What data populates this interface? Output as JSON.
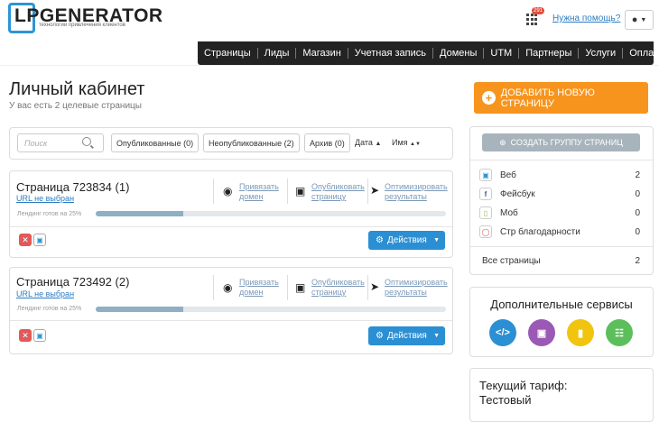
{
  "brand": {
    "name": "LPGENERATOR",
    "tagline": "технологии привлечения клиентов",
    "accent": "#2b95d6"
  },
  "header": {
    "notifications_count": "291",
    "help_link": "Нужна помощь?",
    "user_menu_icon": "user-icon"
  },
  "nav": {
    "items": [
      "Страницы",
      "Лиды",
      "Магазин",
      "Учетная запись",
      "Домены",
      "UTM",
      "Партнеры",
      "Услуги",
      "Оплата"
    ]
  },
  "page": {
    "title": "Личный кабинет",
    "subtitle": "У вас есть 2 целевые страницы",
    "add_button": "ДОБАВИТЬ НОВУЮ СТРАНИЦУ"
  },
  "filter": {
    "search_placeholder": "Поиск",
    "published": "Опубликованные (0)",
    "unpublished": "Неопубликованные (2)",
    "archive": "Архив (0)",
    "sort_date": "Дата",
    "sort_name": "Имя"
  },
  "pages": [
    {
      "title": "Страница 723834 (1)",
      "url": "URL не выбран",
      "progress_label": "Лендинг готов на 25%",
      "progress": 0.25,
      "link_domain": [
        "Привязать",
        "домен"
      ],
      "link_publish": [
        "Опубликовать",
        "страницу"
      ],
      "link_optimize": [
        "Оптимизировать",
        "результаты"
      ],
      "actions": "Действия"
    },
    {
      "title": "Страница 723492 (2)",
      "url": "URL не выбран",
      "progress_label": "Лендинг готов на 25%",
      "progress": 0.25,
      "link_domain": [
        "Привязать",
        "домен"
      ],
      "link_publish": [
        "Опубликовать",
        "страницу"
      ],
      "link_optimize": [
        "Оптимизировать",
        "результаты"
      ],
      "actions": "Действия"
    }
  ],
  "groups": {
    "create_button": "СОЗДАТЬ ГРУППУ СТРАНИЦ",
    "rows": [
      {
        "label": "Веб",
        "value": "2",
        "icon": "monitor-icon"
      },
      {
        "label": "Фейсбук",
        "value": "0",
        "icon": "facebook-icon"
      },
      {
        "label": "Моб",
        "value": "0",
        "icon": "mobile-icon"
      },
      {
        "label": "Стр благодарности",
        "value": "0",
        "icon": "thanks-icon"
      }
    ],
    "total_label": "Все страницы",
    "total_value": "2"
  },
  "services": {
    "title": "Дополнительные сервисы",
    "icons": [
      "code-icon",
      "image-icon",
      "chart-icon",
      "cart-icon"
    ],
    "colors": [
      "#2b8fd3",
      "#9b59b6",
      "#f1c40f",
      "#5cbf5c"
    ]
  },
  "tariff": {
    "line1": "Текущий тариф:",
    "line2": "Тестовый"
  }
}
